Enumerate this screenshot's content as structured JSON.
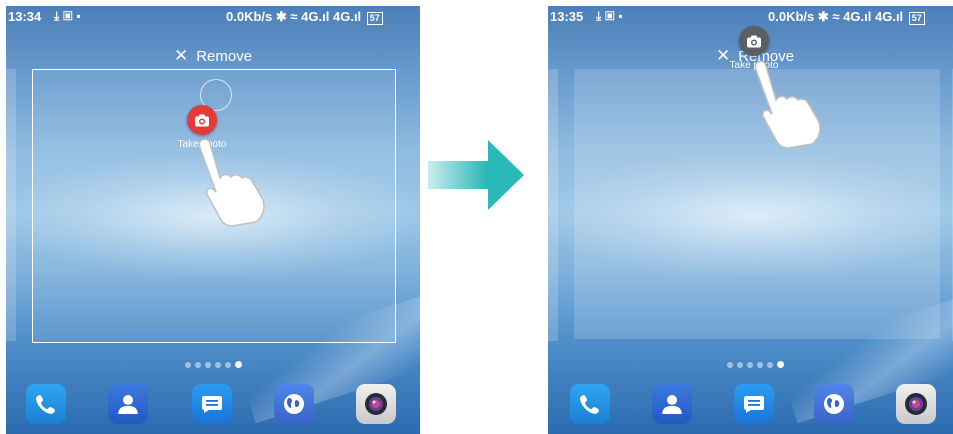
{
  "left_screen": {
    "status": {
      "time": "13:34",
      "speed": "0.0Kb/s",
      "network": "4G",
      "battery": "57"
    },
    "remove_label": "Remove",
    "widget_label": "Take photo",
    "page_dots": {
      "count": 6,
      "active_index": 5
    },
    "dock_apps": [
      "phone-app",
      "contacts-app",
      "messages-app",
      "browser-app",
      "camera-app"
    ]
  },
  "right_screen": {
    "status": {
      "time": "13:35",
      "speed": "0.0Kb/s",
      "network": "4G",
      "battery": "57"
    },
    "remove_label": "Remove",
    "widget_label": "Take photo",
    "page_dots": {
      "count": 6,
      "active_index": 5
    },
    "dock_apps": [
      "phone-app",
      "contacts-app",
      "messages-app",
      "browser-app",
      "camera-app"
    ]
  },
  "colors": {
    "arrow": "#2bb8b8",
    "widget_active": "#e43a3a",
    "widget_dragging": "#5b5f63"
  }
}
